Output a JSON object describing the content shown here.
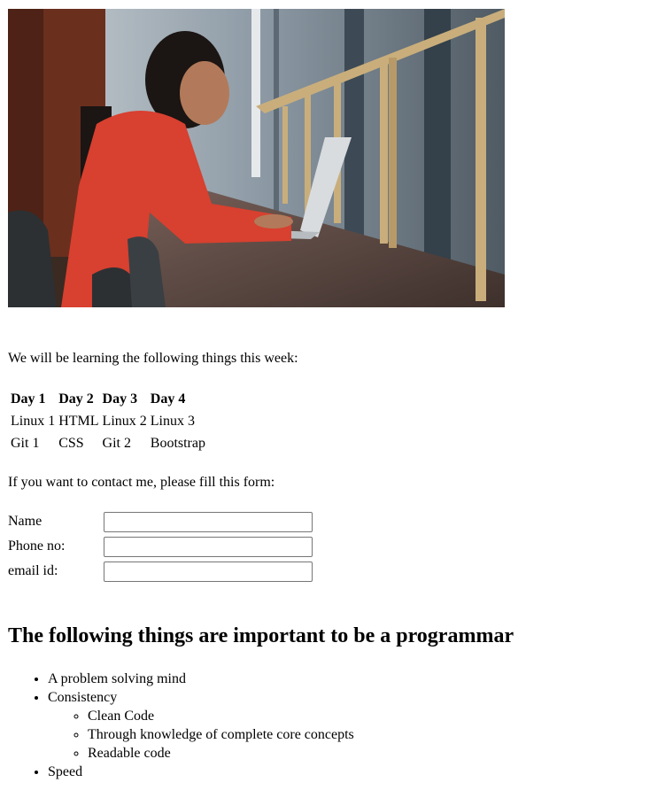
{
  "hero_image": {
    "alt": "Woman in red sweater smiling while working on a laptop at a long counter by a window",
    "colors": {
      "sweater": "#d8402f",
      "wall_left": "#6b2f1e",
      "window": "#9aa8b3",
      "counter": "#5a4640",
      "rail": "#c9ae7c"
    }
  },
  "intro_text": "We will be learning the following things this week:",
  "schedule": {
    "headers": [
      "Day 1",
      "Day 2",
      "Day 3",
      "Day 4"
    ],
    "rows": [
      [
        "Linux 1",
        "HTML",
        "Linux 2",
        "Linux 3"
      ],
      [
        "Git 1",
        "CSS",
        "Git 2",
        "Bootstrap"
      ]
    ]
  },
  "contact_text": "If you want to contact me, please fill this form:",
  "form": {
    "name_label": "Name",
    "phone_label": "Phone no:",
    "email_label": "email id:",
    "name_value": "",
    "phone_value": "",
    "email_value": ""
  },
  "heading": "The following things are important to be a programmar",
  "list": {
    "item1": "A problem solving mind",
    "item2": "Consistency",
    "sub1": "Clean Code",
    "sub2": "Through knowledge of complete core concepts",
    "sub3": "Readable code",
    "item3": "Speed"
  }
}
